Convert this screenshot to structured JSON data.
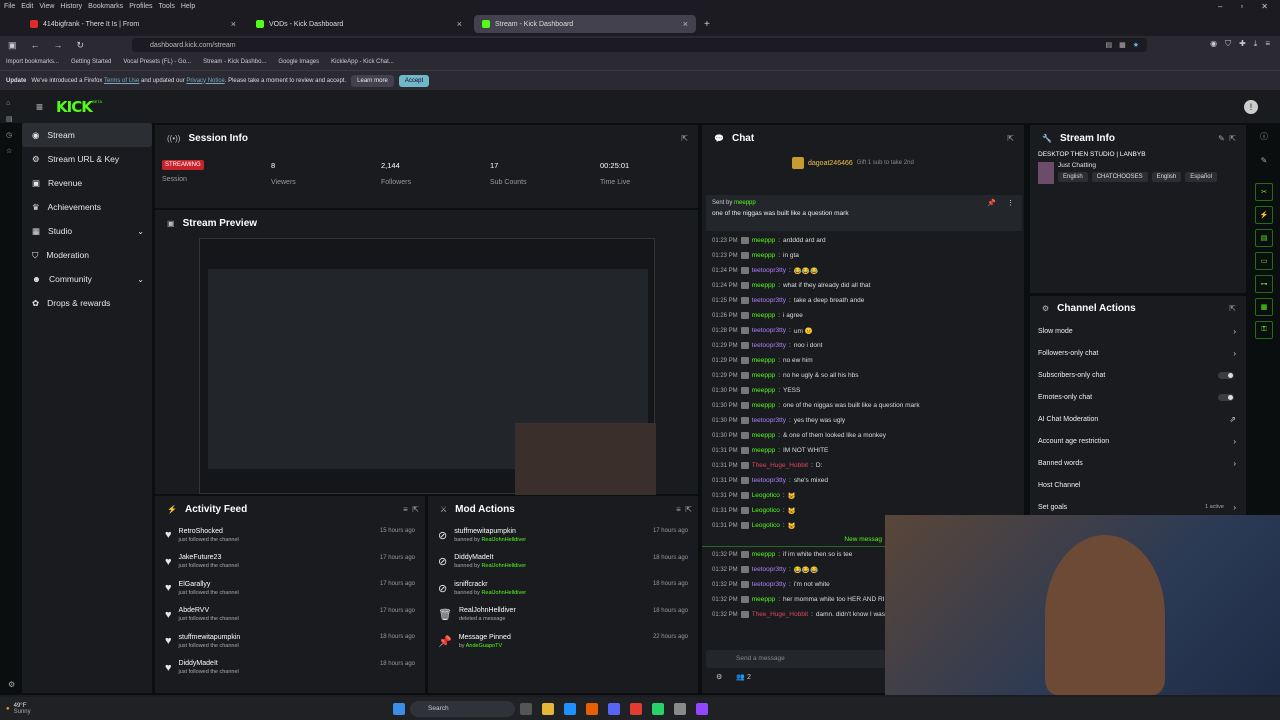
{
  "menubar": [
    "File",
    "Edit",
    "View",
    "History",
    "Bookmarks",
    "Profiles",
    "Tools",
    "Help"
  ],
  "tabs": [
    {
      "label": "414bigfrank - There It Is | From",
      "close": "×"
    },
    {
      "label": "VODs - Kick Dashboard",
      "close": "×"
    },
    {
      "label": "Stream - Kick Dashboard",
      "close": "×"
    }
  ],
  "new_tab": "+",
  "url": "dashboard.kick.com/stream",
  "bookmarks": [
    "Import bookmarks...",
    "Getting Started",
    "Vocal Presets (FL) - Go...",
    "Stream - Kick Dashbo...",
    "Google Images",
    "KickleApp - Kick Chat..."
  ],
  "notification": {
    "prefix": "Update",
    "text1": "We've introduced a Firefox",
    "link1": "Terms of Use",
    "text2": "and updated our",
    "link2": "Privacy Notice",
    "text3": ". Please take a moment to review and accept.",
    "learn": "Learn more",
    "accept": "Accept"
  },
  "logo": "KICK",
  "logo_badge": "BETA",
  "sidebar": [
    {
      "label": "Stream",
      "icon": "stream-icon",
      "chevron": false
    },
    {
      "label": "Stream URL & Key",
      "icon": "gear-icon",
      "chevron": false
    },
    {
      "label": "Revenue",
      "icon": "wallet-icon",
      "chevron": false
    },
    {
      "label": "Achievements",
      "icon": "trophy-icon",
      "chevron": false
    },
    {
      "label": "Studio",
      "icon": "studio-icon",
      "chevron": true
    },
    {
      "label": "Moderation",
      "icon": "shield-icon",
      "chevron": false
    },
    {
      "label": "Community",
      "icon": "users-icon",
      "chevron": true
    },
    {
      "label": "Drops & rewards",
      "icon": "gift-icon",
      "chevron": false
    }
  ],
  "session": {
    "title": "Session Info",
    "badge": "STREAMING",
    "badge_label": "Session",
    "stats": [
      {
        "v": "8",
        "l": "Viewers"
      },
      {
        "v": "2,144",
        "l": "Followers"
      },
      {
        "v": "17",
        "l": "Sub Counts"
      },
      {
        "v": "00:25:01",
        "l": "Time Live"
      }
    ]
  },
  "preview": {
    "title": "Stream Preview"
  },
  "activity": {
    "title": "Activity Feed",
    "items": [
      {
        "name": "RetroShocked",
        "sub": "just followed the channel",
        "time": "15 hours ago"
      },
      {
        "name": "JakeFuture23",
        "sub": "just followed the channel",
        "time": "17 hours ago"
      },
      {
        "name": "ElGarallyy",
        "sub": "just followed the channel",
        "time": "17 hours ago"
      },
      {
        "name": "AbdeRVV",
        "sub": "just followed the channel",
        "time": "17 hours ago"
      },
      {
        "name": "stuffmewitapumpkin",
        "sub": "just followed the channel",
        "time": "18 hours ago"
      },
      {
        "name": "DiddyMadeIt",
        "sub": "just followed the channel",
        "time": "18 hours ago"
      }
    ]
  },
  "mod": {
    "title": "Mod Actions",
    "items": [
      {
        "name": "stuffmewitapumpkin",
        "pre": "banned by",
        "by": "RealJohnHelldiver",
        "time": "17 hours ago"
      },
      {
        "name": "DiddyMadeIt",
        "pre": "banned by",
        "by": "RealJohnHelldiver",
        "time": "18 hours ago"
      },
      {
        "name": "isniffcrackr",
        "pre": "banned by",
        "by": "RealJohnHelldiver",
        "time": "18 hours ago"
      },
      {
        "name": "RealJohnHelldiver",
        "pre": "deleted a message",
        "by": "",
        "time": "18 hours ago"
      },
      {
        "name": "Message Pinned",
        "pre": "by",
        "by": "AndeGuapoTV",
        "time": "22 hours ago"
      }
    ]
  },
  "chat": {
    "title": "Chat",
    "gifter": "dagoat246466",
    "gift_text": "Gift 1 sub to take 2nd",
    "gift_count": "1",
    "pinned_by": "Sent by",
    "pinned_user": "meeppp",
    "pinned_msg": "one of the niggas was built like a question mark",
    "lines": [
      {
        "t": "01:23 PM",
        "u": "meeppp",
        "c": "#53fc18",
        "m": "ardddd ard ard"
      },
      {
        "t": "01:23 PM",
        "u": "meeppp",
        "c": "#53fc18",
        "m": "in gta"
      },
      {
        "t": "01:24 PM",
        "u": "teetoopr3tty",
        "c": "#b27fff",
        "m": "😂😂😂"
      },
      {
        "t": "01:24 PM",
        "u": "meeppp",
        "c": "#53fc18",
        "m": "what if they already did all that"
      },
      {
        "t": "01:25 PM",
        "u": "teetoopr3tty",
        "c": "#b27fff",
        "m": "take a deep breath ande"
      },
      {
        "t": "01:26 PM",
        "u": "meeppp",
        "c": "#53fc18",
        "m": "i agree"
      },
      {
        "t": "01:28 PM",
        "u": "teetoopr3tty",
        "c": "#b27fff",
        "m": "um 😐"
      },
      {
        "t": "01:29 PM",
        "u": "teetoopr3tty",
        "c": "#b27fff",
        "m": "noo i dont"
      },
      {
        "t": "01:29 PM",
        "u": "meeppp",
        "c": "#53fc18",
        "m": "no ew him"
      },
      {
        "t": "01:29 PM",
        "u": "meeppp",
        "c": "#53fc18",
        "m": "no he ugly & so all his hbs"
      },
      {
        "t": "01:30 PM",
        "u": "meeppp",
        "c": "#53fc18",
        "m": "YESS"
      },
      {
        "t": "01:30 PM",
        "u": "meeppp",
        "c": "#53fc18",
        "m": "one of the niggas was built like a question mark"
      },
      {
        "t": "01:30 PM",
        "u": "teetoopr3tty",
        "c": "#b27fff",
        "m": "yes they was ugly"
      },
      {
        "t": "01:30 PM",
        "u": "meeppp",
        "c": "#53fc18",
        "m": "& one of them looked like a monkey"
      },
      {
        "t": "01:31 PM",
        "u": "meeppp",
        "c": "#53fc18",
        "m": "IM NOT WHITE"
      },
      {
        "t": "01:31 PM",
        "u": "Thee_Huge_Hobbit",
        "c": "#e0455b",
        "m": "D:"
      },
      {
        "t": "01:31 PM",
        "u": "teetoopr3tty",
        "c": "#b27fff",
        "m": "she's mixed"
      },
      {
        "t": "01:31 PM",
        "u": "Leogotico",
        "c": "#53fc18",
        "m": "🐱"
      },
      {
        "t": "01:31 PM",
        "u": "Leogotico",
        "c": "#53fc18",
        "m": "🐱"
      },
      {
        "t": "01:31 PM",
        "u": "Leogotico",
        "c": "#53fc18",
        "m": "🐱"
      }
    ],
    "new_messages": "New messag",
    "lines2": [
      {
        "t": "01:32 PM",
        "u": "meeppp",
        "c": "#53fc18",
        "m": "if im white then so is tee"
      },
      {
        "t": "01:32 PM",
        "u": "teetoopr3tty",
        "c": "#b27fff",
        "m": "😂😂😂"
      },
      {
        "t": "01:32 PM",
        "u": "teetoopr3tty",
        "c": "#b27fff",
        "m": "i'm not white"
      },
      {
        "t": "01:32 PM",
        "u": "meeppp",
        "c": "#53fc18",
        "m": "her momma white too HER AND RI"
      },
      {
        "t": "01:32 PM",
        "u": "Thee_Huge_Hobbit",
        "c": "#e0455b",
        "m": "damn. didn't know I was a"
      }
    ],
    "placeholder": "Send a message",
    "viewer_count": "2"
  },
  "streaminfo": {
    "title": "Stream Info",
    "stream_title": "DESKTOP THEN STUDIO | LANBYB",
    "category": "Just Chatting",
    "tags": [
      "English",
      "CHATCHOOSES",
      "English",
      "Español"
    ]
  },
  "channel": {
    "title": "Channel Actions",
    "items": [
      {
        "label": "Slow mode",
        "kind": "chev"
      },
      {
        "label": "Followers-only chat",
        "kind": "chev"
      },
      {
        "label": "Subscribers-only chat",
        "kind": "toggle"
      },
      {
        "label": "Emotes-only chat",
        "kind": "toggle"
      },
      {
        "label": "AI Chat Moderation",
        "kind": "ext"
      },
      {
        "label": "Account age restriction",
        "kind": "chev"
      },
      {
        "label": "Banned words",
        "kind": "chev"
      },
      {
        "label": "Host Channel",
        "kind": "none"
      },
      {
        "label": "Set goals",
        "kind": "active",
        "extra": "1 active"
      }
    ]
  },
  "taskbar": {
    "weather_temp": "49°F",
    "weather_desc": "Sunny",
    "search": "Search"
  }
}
